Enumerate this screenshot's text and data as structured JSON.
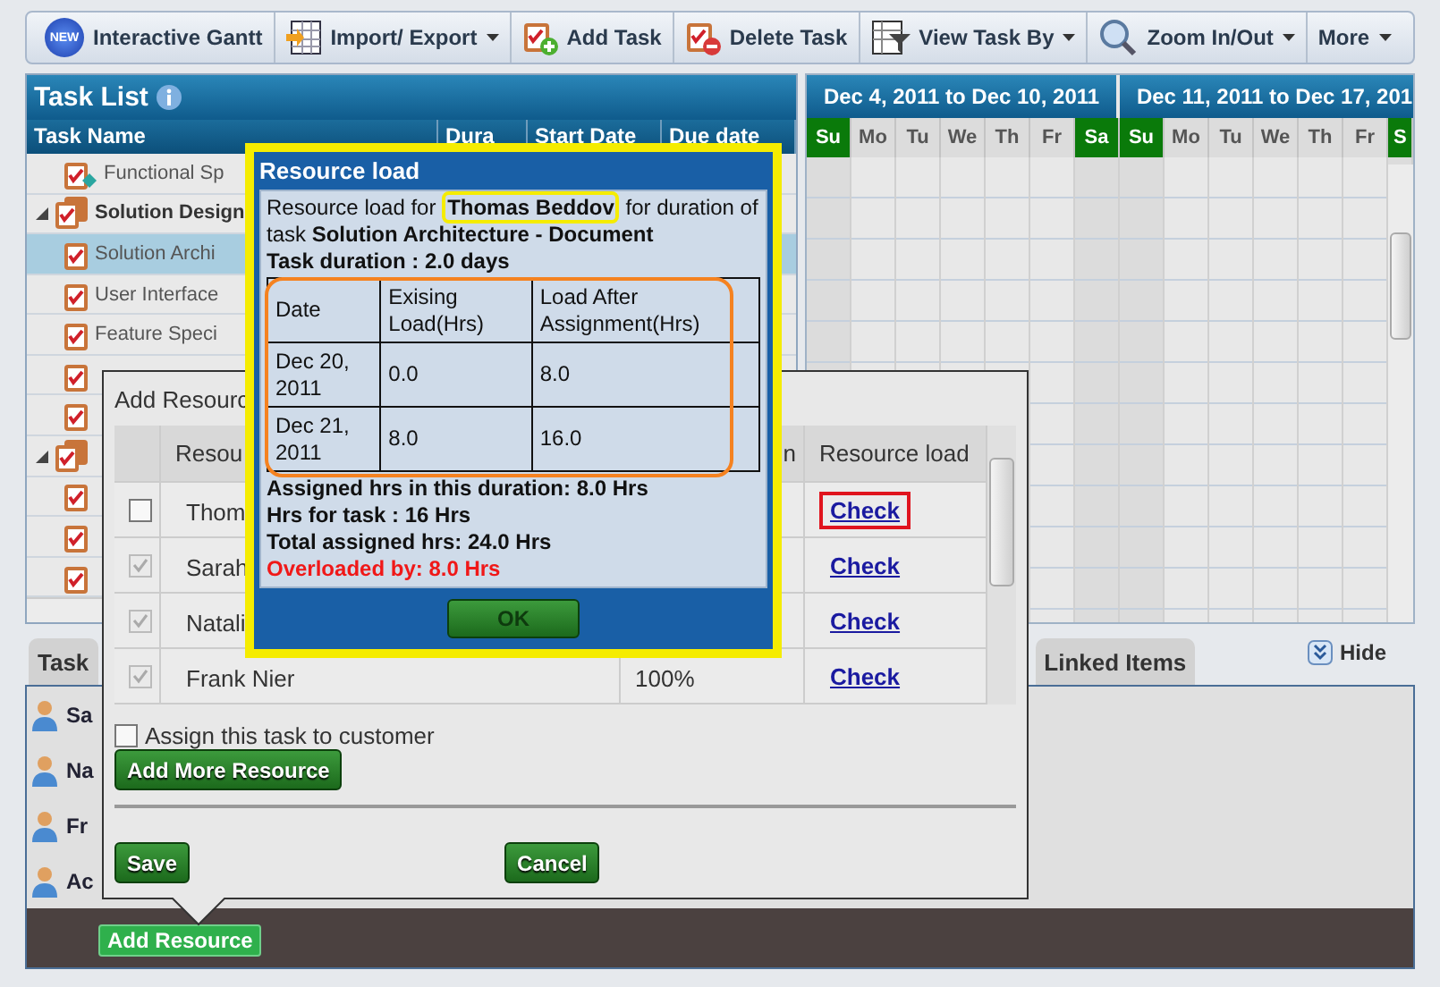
{
  "toolbar": [
    {
      "kind": "new",
      "label": "Interactive Gantt",
      "badge": "NEW",
      "dropdown": false
    },
    {
      "kind": "import",
      "label": "Import/ Export",
      "dropdown": true
    },
    {
      "kind": "add",
      "label": "Add Task",
      "dropdown": false
    },
    {
      "kind": "delete",
      "label": "Delete Task",
      "dropdown": false
    },
    {
      "kind": "view",
      "label": "View Task By",
      "dropdown": true
    },
    {
      "kind": "zoom",
      "label": "Zoom In/Out",
      "dropdown": true
    },
    {
      "kind": "more",
      "label": "More",
      "dropdown": true
    }
  ],
  "task_list": {
    "title": "Task List",
    "columns": [
      "Task Name",
      "Dura",
      "Start Date",
      "Due date"
    ],
    "rows": [
      {
        "kind": "milestone",
        "name": "Functional Sp",
        "selected": false
      },
      {
        "kind": "group",
        "name": "Solution Design",
        "expanded": true,
        "selected": false,
        "children": [
          {
            "kind": "task",
            "name": "Solution Archi",
            "selected": true
          },
          {
            "kind": "task",
            "name": "User Interface",
            "selected": false
          },
          {
            "kind": "task",
            "name": "Feature Speci",
            "selected": false
          },
          {
            "kind": "task",
            "selected": false
          },
          {
            "kind": "task",
            "selected": false
          }
        ]
      },
      {
        "kind": "group",
        "expanded": true,
        "selected": false,
        "children": [
          {
            "kind": "task",
            "selected": false
          },
          {
            "kind": "task",
            "selected": false
          },
          {
            "kind": "task",
            "selected": false
          }
        ]
      }
    ]
  },
  "gantt": {
    "weeks": [
      {
        "title": "Dec 4, 2011 to Dec 10, 2011",
        "days": [
          {
            "label": "Su",
            "weekend": true
          },
          {
            "label": "Mo",
            "weekend": false
          },
          {
            "label": "Tu",
            "weekend": false
          },
          {
            "label": "We",
            "weekend": false
          },
          {
            "label": "Th",
            "weekend": false
          },
          {
            "label": "Fr",
            "weekend": false
          },
          {
            "label": "Sa",
            "weekend": true
          }
        ]
      },
      {
        "title": "Dec 11, 2011 to Dec 17, 201",
        "days": [
          {
            "label": "Su",
            "weekend": true
          },
          {
            "label": "Mo",
            "weekend": false
          },
          {
            "label": "Tu",
            "weekend": false
          },
          {
            "label": "We",
            "weekend": false
          },
          {
            "label": "Th",
            "weekend": false
          },
          {
            "label": "Fr",
            "weekend": false
          },
          {
            "label": "S",
            "weekend": true
          }
        ]
      }
    ]
  },
  "details": {
    "tabs": [
      {
        "label": "Task"
      },
      {
        "label": "Linked Items"
      }
    ],
    "hide": "Hide",
    "resources": [
      "Sa",
      "Na",
      "Fr",
      "Ac"
    ],
    "add_button": "Add Resource"
  },
  "add_dialog": {
    "title": "Add Resourc",
    "columns": [
      "Resou",
      "n",
      "Resource load"
    ],
    "rows": [
      {
        "name": "Thom",
        "checked": false,
        "disabled": false,
        "link": "Check",
        "highlighted": true
      },
      {
        "name": "Sarah",
        "checked": true,
        "disabled": true,
        "link": "Check",
        "highlighted": false
      },
      {
        "name": "Natali",
        "checked": true,
        "disabled": true,
        "link": "Check",
        "highlighted": false
      },
      {
        "name": "Frank Nier",
        "allocation": "100%",
        "checked": true,
        "disabled": true,
        "link": "Check",
        "highlighted": false
      }
    ],
    "assign": {
      "label": "Assign this task to customer",
      "checked": false
    },
    "add_more": "Add More Resource",
    "save": "Save",
    "cancel": "Cancel"
  },
  "resource_load": {
    "title": "Resource load",
    "intro_before": "Resource load for",
    "resource": "Thomas Beddov",
    "intro_after": "for duration of task **Solution Architecture - Document**",
    "duration": "Task duration : 2.0 days",
    "columns": [
      "Date",
      "Exising Load(Hrs)",
      "Load After Assignment(Hrs)"
    ],
    "rows": [
      [
        "Dec 20, 2011",
        "0.0",
        "8.0"
      ],
      [
        "Dec 21, 2011",
        "8.0",
        "16.0"
      ]
    ],
    "summary": [
      "Assigned hrs in this duration: 8.0 Hrs",
      "Hrs for task : 16 Hrs",
      "Total assigned hrs: 24.0 Hrs"
    ],
    "overloaded": "Overloaded by: 8.0 Hrs",
    "ok": {
      "label": "OK",
      "disabled": true
    }
  }
}
